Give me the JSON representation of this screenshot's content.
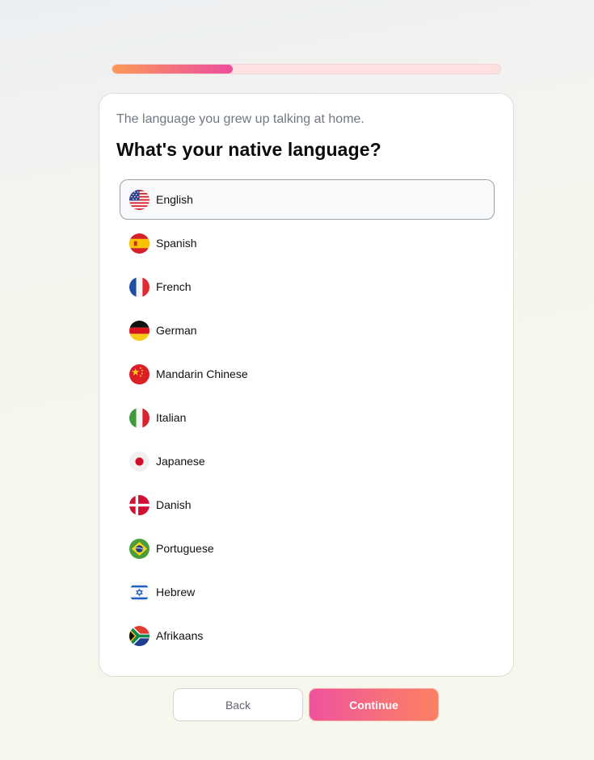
{
  "progress": {
    "value": 0.31
  },
  "card": {
    "subtitle": "The language you grew up talking at home.",
    "question": "What's your native language?"
  },
  "options": [
    {
      "label": "English",
      "flag": "us-flag-icon",
      "selected": true
    },
    {
      "label": "Spanish",
      "flag": "spain-flag-icon",
      "selected": false
    },
    {
      "label": "French",
      "flag": "france-flag-icon",
      "selected": false
    },
    {
      "label": "German",
      "flag": "germany-flag-icon",
      "selected": false
    },
    {
      "label": "Mandarin Chinese",
      "flag": "china-flag-icon",
      "selected": false
    },
    {
      "label": "Italian",
      "flag": "italy-flag-icon",
      "selected": false
    },
    {
      "label": "Japanese",
      "flag": "japan-flag-icon",
      "selected": false
    },
    {
      "label": "Danish",
      "flag": "denmark-flag-icon",
      "selected": false
    },
    {
      "label": "Portuguese",
      "flag": "brazil-flag-icon",
      "selected": false
    },
    {
      "label": "Hebrew",
      "flag": "israel-flag-icon",
      "selected": false
    },
    {
      "label": "Afrikaans",
      "flag": "south-africa-flag-icon",
      "selected": false
    }
  ],
  "buttons": {
    "back": "Back",
    "continue": "Continue"
  },
  "colors": {
    "accent_start": "#fb9a55",
    "accent_end": "#ee4f9b",
    "track": "#fde0e0"
  }
}
